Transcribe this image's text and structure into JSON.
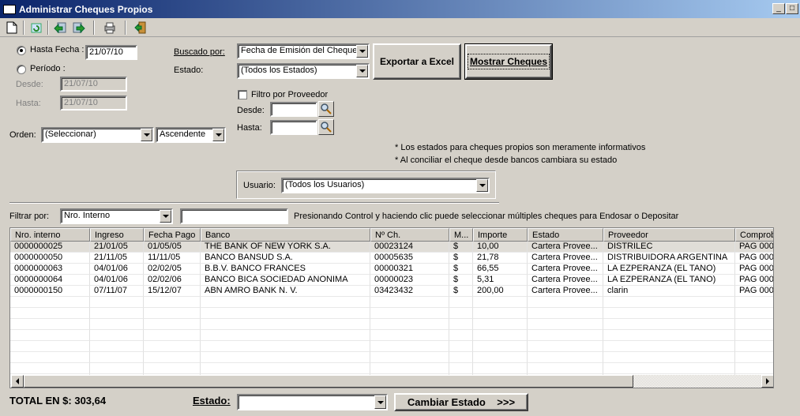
{
  "window": {
    "title": "Administrar Cheques Propios",
    "minimize_glyph": "_",
    "maximize_glyph": "□"
  },
  "toolbar": {
    "icons": [
      "new-document-icon",
      "refresh-icon",
      "back-icon",
      "forward-icon",
      "print-icon",
      "exit-icon"
    ]
  },
  "filters": {
    "hasta_fecha_label": "Hasta Fecha :",
    "hasta_fecha_value": "21/07/10",
    "periodo_label": "Período :",
    "desde_label": "Desde:",
    "desde_value": "21/07/10",
    "hasta_label": "Hasta:",
    "hasta_value": "21/07/10",
    "buscado_por_label": "Buscado por:",
    "buscado_por_value": "Fecha de Emisión del Cheque",
    "estado_label": "Estado:",
    "estado_value": "(Todos los Estados)",
    "filtro_proveedor_label": "Filtro por Proveedor",
    "prov_desde_label": "Desde:",
    "prov_hasta_label": "Hasta:",
    "orden_label": "Orden:",
    "orden_value": "(Seleccionar)",
    "orden_dir_value": "Ascendente",
    "note1": "* Los estados para cheques propios son meramente informativos",
    "note2": "* Al conciliar el cheque desde bancos cambiara su estado",
    "usuario_label": "Usuario:",
    "usuario_value": "(Todos los Usuarios)",
    "filtrar_por_label": "Filtrar por:",
    "filtrar_por_value": "Nro. Interno",
    "hint": "Presionando Control y haciendo clic puede seleccionar múltiples cheques para Endosar o Depositar"
  },
  "buttons": {
    "exportar": "Exportar a Excel",
    "mostrar": "Mostrar Cheques",
    "cambiar": "Cambiar Estado    >>>"
  },
  "grid": {
    "columns": [
      "Nro. interno",
      "Ingreso",
      "Fecha Pago",
      "Banco",
      "Nº Ch.",
      "M...",
      "Importe",
      "Estado",
      "Proveedor",
      "Comproba"
    ],
    "rows": [
      [
        "0000000025",
        "21/01/05",
        "01/05/05",
        "THE BANK OF NEW YORK S.A.",
        "00023124",
        "$",
        "10,00",
        "Cartera Provee...",
        "DISTRILEC",
        "PAG  000"
      ],
      [
        "0000000050",
        "21/11/05",
        "11/11/05",
        "BANCO BANSUD S.A.",
        "00005635",
        "$",
        "21,78",
        "Cartera Provee...",
        "DISTRIBUIDORA ARGENTINA",
        "PAG  000"
      ],
      [
        "0000000063",
        "04/01/06",
        "02/02/05",
        "B.B.V. BANCO FRANCES",
        "00000321",
        "$",
        "66,55",
        "Cartera Provee...",
        "LA EZPERANZA (EL TANO)",
        "PAG  000"
      ],
      [
        "0000000064",
        "04/01/06",
        "02/02/06",
        "BANCO BICA SOCIEDAD ANONIMA",
        "00000023",
        "$",
        "5,31",
        "Cartera Provee...",
        "LA EZPERANZA (EL TANO)",
        "PAG  000"
      ],
      [
        "0000000150",
        "07/11/07",
        "15/12/07",
        "ABN AMRO BANK N. V.",
        "03423432",
        "$",
        "200,00",
        "Cartera Provee...",
        "clarin",
        "PAG  000"
      ]
    ]
  },
  "footer": {
    "total_label": "TOTAL EN $: 303,64",
    "estado_label": "Estado:",
    "estado_value": ""
  }
}
